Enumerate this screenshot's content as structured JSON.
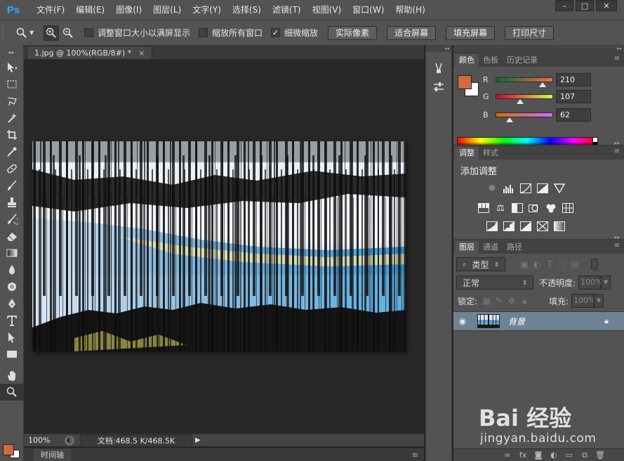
{
  "app": {
    "logo": "Ps"
  },
  "menu": [
    "文件(F)",
    "编辑(E)",
    "图像(I)",
    "图层(L)",
    "文字(Y)",
    "选择(S)",
    "滤镜(T)",
    "视图(V)",
    "窗口(W)",
    "帮助(H)"
  ],
  "window_controls": {
    "minimize": "–",
    "maximize": "□",
    "close": "✕"
  },
  "options": {
    "resize_windows_label": "调整窗口大小以满屏显示",
    "resize_windows_checked": false,
    "zoom_all_label": "缩放所有窗口",
    "zoom_all_checked": false,
    "scrubby_zoom_label": "细微缩放",
    "scrubby_zoom_checked": true,
    "actual_pixels": "实际像素",
    "fit_screen": "适合屏幕",
    "fill_screen": "填充屏幕",
    "print_size": "打印尺寸"
  },
  "document": {
    "tab_title": "1.jpg @ 100%(RGB/8#) *",
    "tab_close": "×"
  },
  "status": {
    "zoom": "100%",
    "doc_size": "文档:468.5 K/468.5K",
    "arrow": "▶"
  },
  "timeline": {
    "tab": "时间轴"
  },
  "color_panel": {
    "tabs": [
      "颜色",
      "色板",
      "历史记录"
    ],
    "fg_color": "#d2693e",
    "r_label": "R",
    "r_value": "210",
    "r_level": 0.82,
    "g_label": "G",
    "g_value": "107",
    "g_level": 0.42,
    "b_label": "B",
    "b_value": "62",
    "b_level": 0.24
  },
  "adjustments_panel": {
    "tabs": [
      "调整",
      "样式"
    ],
    "title": "添加调整"
  },
  "layers_panel": {
    "tabs": [
      "图层",
      "通道",
      "路径"
    ],
    "kind_filter": "类型",
    "blend_mode": "正常",
    "opacity_label": "不透明度:",
    "opacity_value": "100%",
    "lock_label": "锁定:",
    "fill_label": "填充:",
    "fill_value": "100%",
    "layer_name": "背景"
  },
  "watermark": {
    "logo": "Bai 经验",
    "sub": "jingyan.baidu.com"
  }
}
